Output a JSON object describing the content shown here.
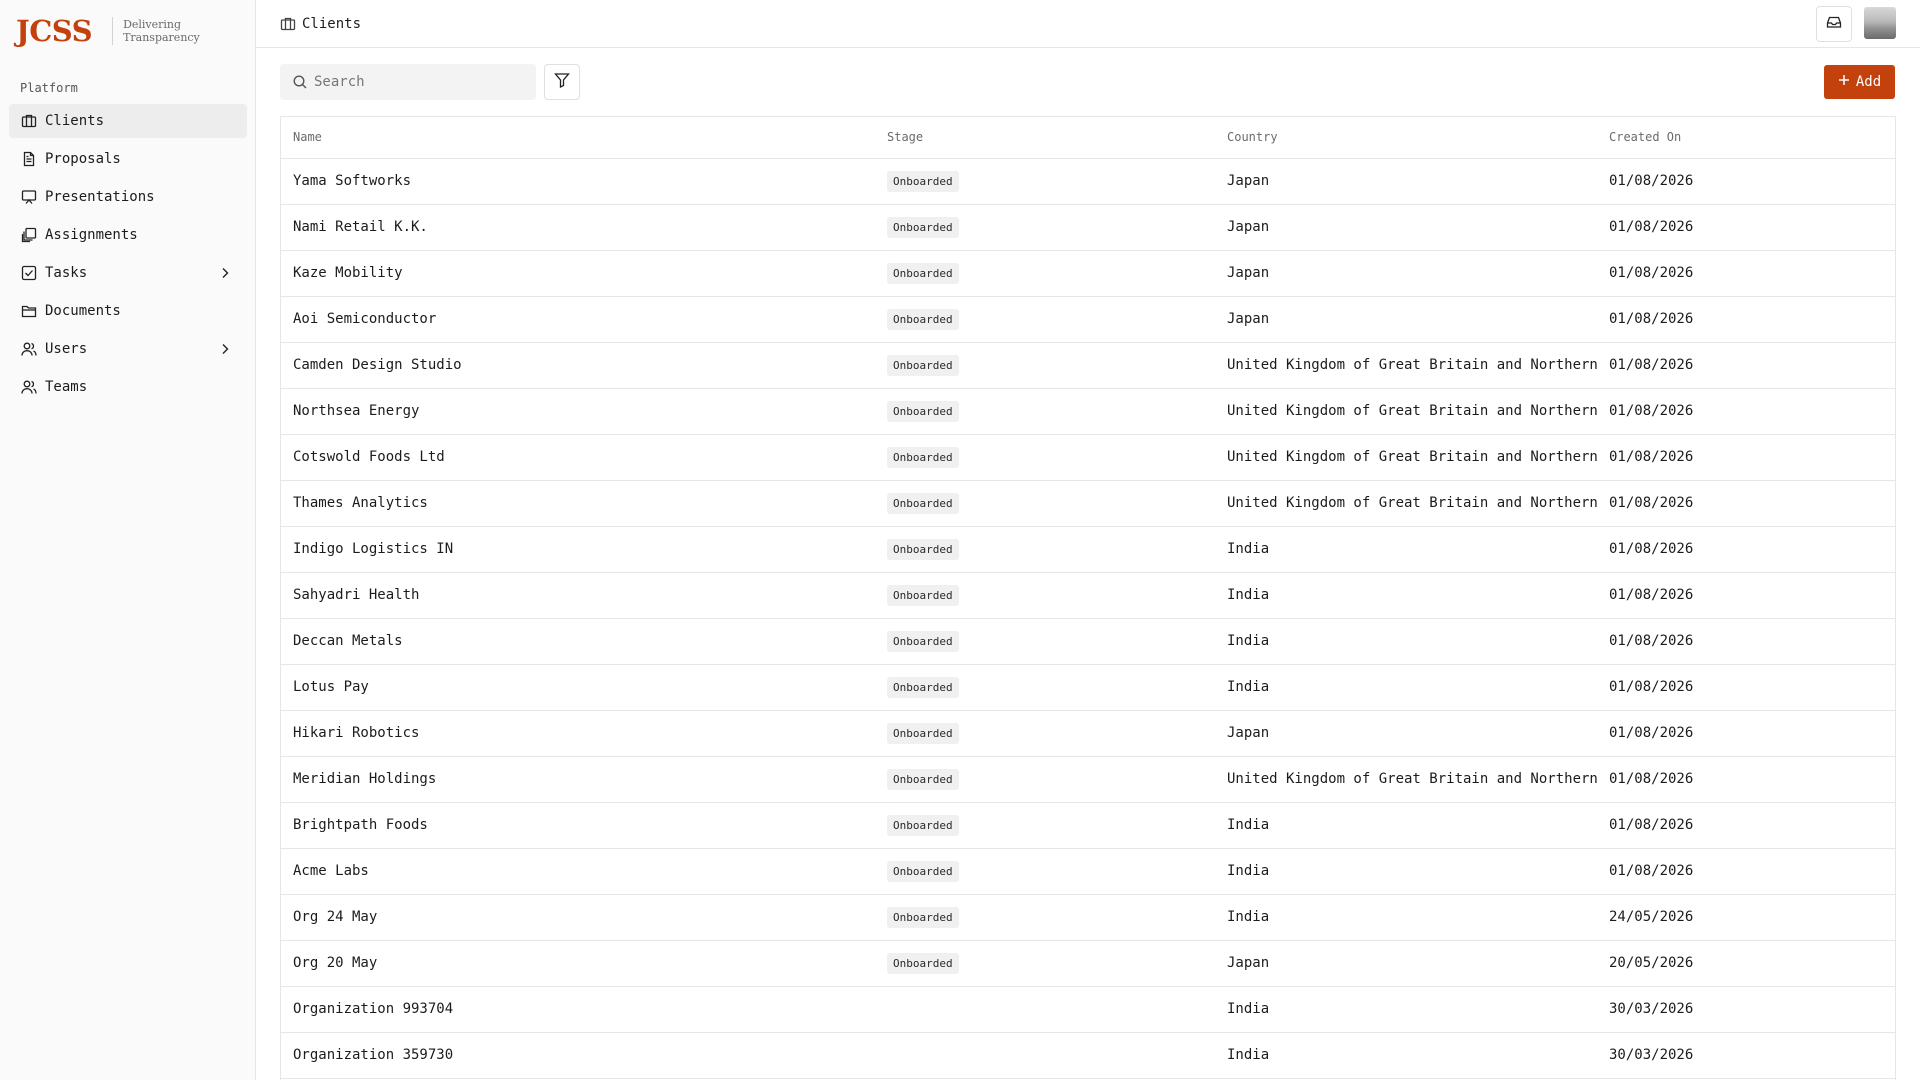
{
  "brand": {
    "logo": "JCSS",
    "tagline_line1": "Delivering",
    "tagline_line2": "Transparency"
  },
  "sidebar": {
    "section_label": "Platform",
    "items": [
      {
        "label": "Clients",
        "icon": "building-icon",
        "active": true
      },
      {
        "label": "Proposals",
        "icon": "file-text-icon"
      },
      {
        "label": "Presentations",
        "icon": "presentation-icon"
      },
      {
        "label": "Assignments",
        "icon": "stack-icon"
      },
      {
        "label": "Tasks",
        "icon": "checkbox-icon",
        "expandable": true
      },
      {
        "label": "Documents",
        "icon": "folder-icon"
      },
      {
        "label": "Users",
        "icon": "users-icon",
        "expandable": true
      },
      {
        "label": "Teams",
        "icon": "team-icon"
      }
    ]
  },
  "header": {
    "breadcrumb": "Clients"
  },
  "toolbar": {
    "search_placeholder": "Search",
    "add_label": "Add"
  },
  "colors": {
    "accent": "#c2410c",
    "sidebar_bg": "#fafafa",
    "badge_bg": "#f0f0f0"
  },
  "table": {
    "columns": [
      "Name",
      "Stage",
      "Country",
      "Created On"
    ],
    "rows": [
      {
        "name": "Yama Softworks",
        "stage": "Onboarded",
        "country": "Japan",
        "created": "01/08/2026"
      },
      {
        "name": "Nami Retail K.K.",
        "stage": "Onboarded",
        "country": "Japan",
        "created": "01/08/2026"
      },
      {
        "name": "Kaze Mobility",
        "stage": "Onboarded",
        "country": "Japan",
        "created": "01/08/2026"
      },
      {
        "name": "Aoi Semiconductor",
        "stage": "Onboarded",
        "country": "Japan",
        "created": "01/08/2026"
      },
      {
        "name": "Camden Design Studio",
        "stage": "Onboarded",
        "country": "United Kingdom of Great Britain and Northern",
        "created": "01/08/2026"
      },
      {
        "name": "Northsea Energy",
        "stage": "Onboarded",
        "country": "United Kingdom of Great Britain and Northern",
        "created": "01/08/2026"
      },
      {
        "name": "Cotswold Foods Ltd",
        "stage": "Onboarded",
        "country": "United Kingdom of Great Britain and Northern",
        "created": "01/08/2026"
      },
      {
        "name": "Thames Analytics",
        "stage": "Onboarded",
        "country": "United Kingdom of Great Britain and Northern",
        "created": "01/08/2026"
      },
      {
        "name": "Indigo Logistics IN",
        "stage": "Onboarded",
        "country": "India",
        "created": "01/08/2026"
      },
      {
        "name": "Sahyadri Health",
        "stage": "Onboarded",
        "country": "India",
        "created": "01/08/2026"
      },
      {
        "name": "Deccan Metals",
        "stage": "Onboarded",
        "country": "India",
        "created": "01/08/2026"
      },
      {
        "name": "Lotus Pay",
        "stage": "Onboarded",
        "country": "India",
        "created": "01/08/2026"
      },
      {
        "name": "Hikari Robotics",
        "stage": "Onboarded",
        "country": "Japan",
        "created": "01/08/2026"
      },
      {
        "name": "Meridian Holdings",
        "stage": "Onboarded",
        "country": "United Kingdom of Great Britain and Northern",
        "created": "01/08/2026"
      },
      {
        "name": "Brightpath Foods",
        "stage": "Onboarded",
        "country": "India",
        "created": "01/08/2026"
      },
      {
        "name": "Acme Labs",
        "stage": "Onboarded",
        "country": "India",
        "created": "01/08/2026"
      },
      {
        "name": "Org 24 May",
        "stage": "Onboarded",
        "country": "India",
        "created": "24/05/2026"
      },
      {
        "name": "Org 20 May",
        "stage": "Onboarded",
        "country": "Japan",
        "created": "20/05/2026"
      },
      {
        "name": "Organization 993704",
        "stage": "",
        "country": "India",
        "created": "30/03/2026"
      },
      {
        "name": "Organization 359730",
        "stage": "",
        "country": "India",
        "created": "30/03/2026"
      }
    ]
  }
}
